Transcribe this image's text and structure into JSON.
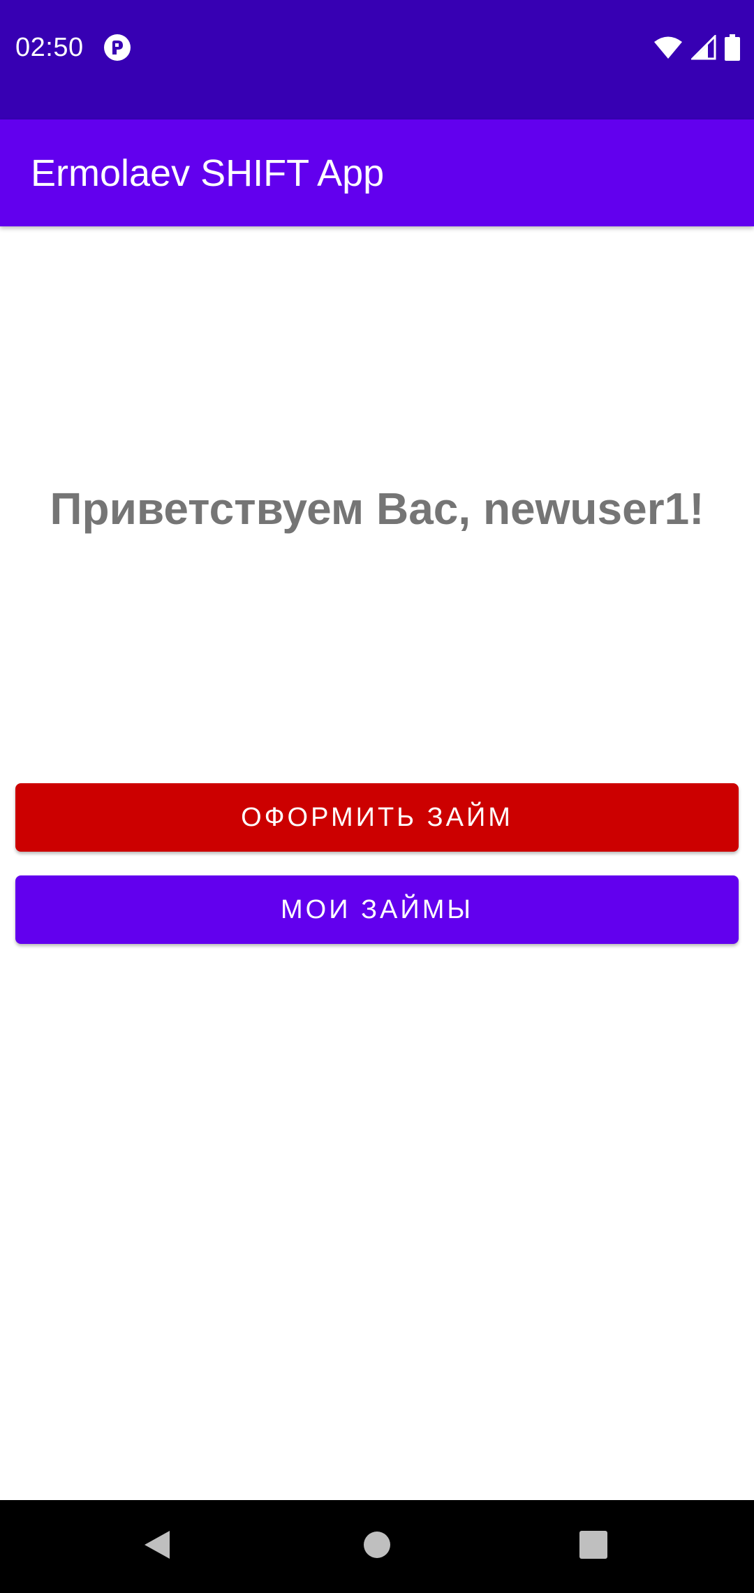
{
  "status_bar": {
    "time": "02:50",
    "background_color": "#3700B3",
    "icons": [
      "app-notification-icon",
      "wifi-icon",
      "signal-icon",
      "battery-icon"
    ]
  },
  "app_bar": {
    "title": "Ermolaev SHIFT App",
    "background_color": "#6200EE"
  },
  "main": {
    "greeting": "Приветствуем Вас, newuser1!",
    "apply_loan_button": {
      "label": "ОФОРМИТЬ ЗАЙМ",
      "color": "#CC0000"
    },
    "my_loans_button": {
      "label": "МОИ ЗАЙМЫ",
      "color": "#6200EE"
    }
  },
  "nav_bar": {
    "buttons": [
      "back-icon",
      "home-icon",
      "recents-icon"
    ]
  }
}
